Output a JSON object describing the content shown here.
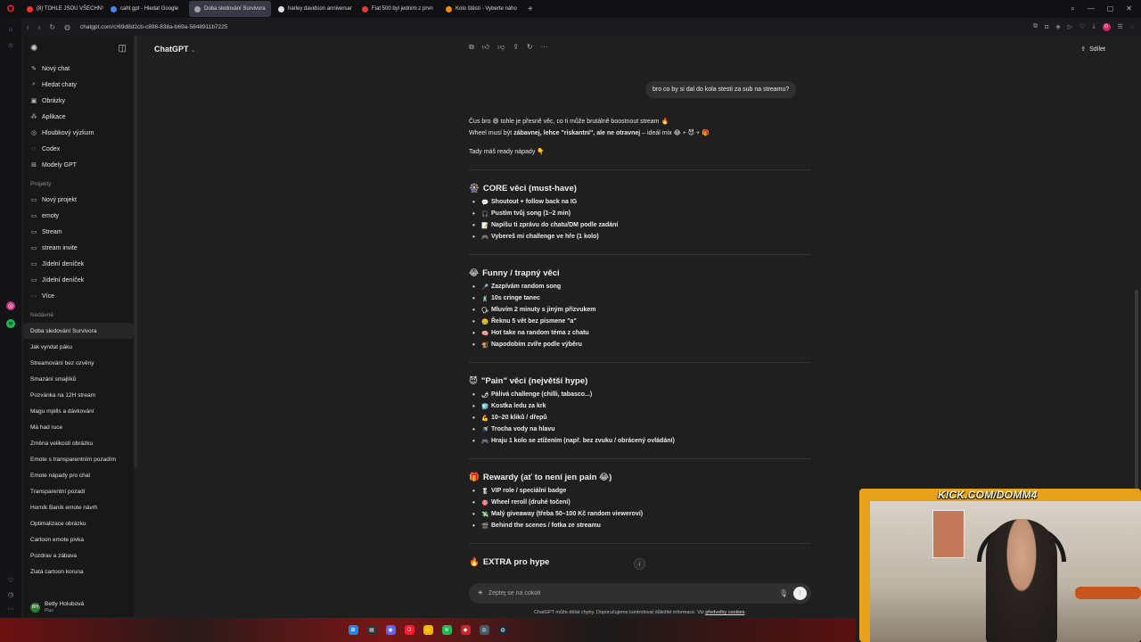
{
  "browser": {
    "tabs": [
      {
        "label": "(8) TOHLE JSOU VŠECHNY",
        "color": "#ff2d2d",
        "active": false
      },
      {
        "label": "caht gpt - Hledat Google",
        "color": "#4285f4",
        "active": false
      },
      {
        "label": "Doba sledování Survivora",
        "color": "#a0a0a0",
        "active": true
      },
      {
        "label": "harley davidson anniversar",
        "color": "#e0e0e0",
        "active": false
      },
      {
        "label": "Fiat 500 byl jedním z prvn",
        "color": "#e53935",
        "active": false
      },
      {
        "label": "Kolo štěstí - Vyberte náho",
        "color": "#fb8c00",
        "active": false
      }
    ],
    "url": "chatgpt.com/c/69d8d2cb-c898-838a-b69a-5848911b7225",
    "profile_initial": "D"
  },
  "sidebar": {
    "nav": [
      {
        "icon": "compose-icon",
        "glyph": "✎",
        "label": "Nový chat"
      },
      {
        "icon": "search-icon",
        "glyph": "⌕",
        "label": "Hledat chaty"
      },
      {
        "icon": "image-icon",
        "glyph": "▣",
        "label": "Obrázky"
      },
      {
        "icon": "apps-icon",
        "glyph": "⁂",
        "label": "Aplikace"
      },
      {
        "icon": "research-icon",
        "glyph": "◎",
        "label": "Hloubkový výzkum"
      },
      {
        "icon": "codex-icon",
        "glyph": "◌",
        "label": "Codex"
      },
      {
        "icon": "gpts-icon",
        "glyph": "⊞",
        "label": "Modely GPT"
      }
    ],
    "projects_heading": "Projekty",
    "projects": [
      {
        "icon": "new-folder-icon",
        "glyph": "▭",
        "label": "Nový projekt"
      },
      {
        "icon": "folder-icon",
        "glyph": "▭",
        "label": "emoty"
      },
      {
        "icon": "folder-icon",
        "glyph": "▭",
        "label": "Stream"
      },
      {
        "icon": "folder-icon",
        "glyph": "▭",
        "label": "stream invite"
      },
      {
        "icon": "folder-icon",
        "glyph": "▭",
        "label": "Jídelní deníček"
      },
      {
        "icon": "folder-icon",
        "glyph": "▭",
        "label": "Jídelní deníček"
      },
      {
        "icon": "more-icon",
        "glyph": "···",
        "label": "Více"
      }
    ],
    "recent_heading": "Nedávné",
    "recent": [
      "Doba sledování Survivora",
      "Jak vyndat páku",
      "Streamování bez ozvěny",
      "Smazání smajlíků",
      "Pozvánka na 12H stream",
      "Magu mpills a dávkování",
      "Má had ruce",
      "Změna velikosti obrázku",
      "Emote s transparentním pozadím",
      "Emote nápady pro chat",
      "Transparentní pozadí",
      "Horník Baník emote návrh",
      "Optimalizace obrázku",
      "Cartoon emote pivka",
      "Pozdrav a zábava",
      "Zlatá cartoon koruna"
    ],
    "user": {
      "initials": "BH",
      "name": "Betty Holubová",
      "plan": "Plus"
    }
  },
  "header": {
    "model": "ChatGPT",
    "share_label": "Sdílet"
  },
  "conversation": {
    "user_message": "bro co by si dal do kola stesti za sub na streamu?",
    "intro_line1": "Čus bro 😄 tohle je přesně věc, co ti může brutálně boostnout stream 🔥",
    "intro_line2_pre": "Wheel musí být ",
    "intro_line2_bold": "zábavnej, lehce \"riskantní\", ale ne otravnej",
    "intro_line2_post": " – ideál mix 😂 + 😈 + 🎁",
    "intro_line3": "Tady máš ready nápady 👇",
    "sections": [
      {
        "emoji": "🎡",
        "title": "CORE věci (must-have)",
        "items": [
          {
            "emoji": "💬",
            "text": "Shoutout + follow back na IG"
          },
          {
            "emoji": "🎧",
            "text": "Pustím tvůj song (1–2 min)"
          },
          {
            "emoji": "📝",
            "text": "Napíšu ti zprávu do chatu/DM podle zadání"
          },
          {
            "emoji": "🎮",
            "text": "Vybereš mi challenge ve hře (1 kolo)"
          }
        ]
      },
      {
        "emoji": "😂",
        "title": "Funny / trapný věci",
        "items": [
          {
            "emoji": "🎤",
            "text": "Zazpívám random song"
          },
          {
            "emoji": "🕺",
            "text": "10s cringe tanec"
          },
          {
            "emoji": "🗣",
            "text": "Mluvím 2 minuty s jiným přízvukem"
          },
          {
            "emoji": "🤐",
            "text": "Řeknu 5 vět bez písmene \"a\""
          },
          {
            "emoji": "🧠",
            "text": "Hot take na random téma z chatu"
          },
          {
            "emoji": "🐒",
            "text": "Napodobím zvíře podle výběru"
          }
        ]
      },
      {
        "emoji": "😈",
        "title": "\"Pain\" věci (největší hype)",
        "items": [
          {
            "emoji": "🌶",
            "text": "Pálivá challenge (chilli, tabasco...)"
          },
          {
            "emoji": "🧊",
            "text": "Kostka ledu za krk"
          },
          {
            "emoji": "💪",
            "text": "10–20 kliků / dřepů"
          },
          {
            "emoji": "🚿",
            "text": "Trocha vody na hlavu"
          },
          {
            "emoji": "🎮",
            "text": "Hraju 1 kolo se ztížením (např. bez zvuku / obrácený ovládání)"
          }
        ]
      },
      {
        "emoji": "🎁",
        "title": "Rewardy (ať to není jen pain 😂)",
        "items": [
          {
            "emoji": "🎖",
            "text": "VIP role / speciální badge"
          },
          {
            "emoji": "🎯",
            "text": "Wheel reroll (druhé točení)"
          },
          {
            "emoji": "💸",
            "text": "Malý giveaway (třeba 50–100 Kč random viewerovi)"
          },
          {
            "emoji": "🎬",
            "text": "Behind the scenes / fotka ze streamu"
          }
        ]
      },
      {
        "emoji": "🔥",
        "title": "EXTRA pro hype",
        "items": []
      }
    ]
  },
  "composer": {
    "placeholder": "Zeptej se na cokoli",
    "disclaimer": "ChatGPT může dělat chyby. Doporučujeme kontrolovat důležité informace. Viz ",
    "disclaimer_link": "předvolby cookies",
    "disclaimer_end": "."
  },
  "overlay": {
    "title": "KICK.COM/DOMM4"
  },
  "colors": {
    "background": "#1f1f1f",
    "sidebar": "#181818",
    "overlay_frame": "#e8a21a",
    "browser_accent": "#ff1b2d"
  }
}
